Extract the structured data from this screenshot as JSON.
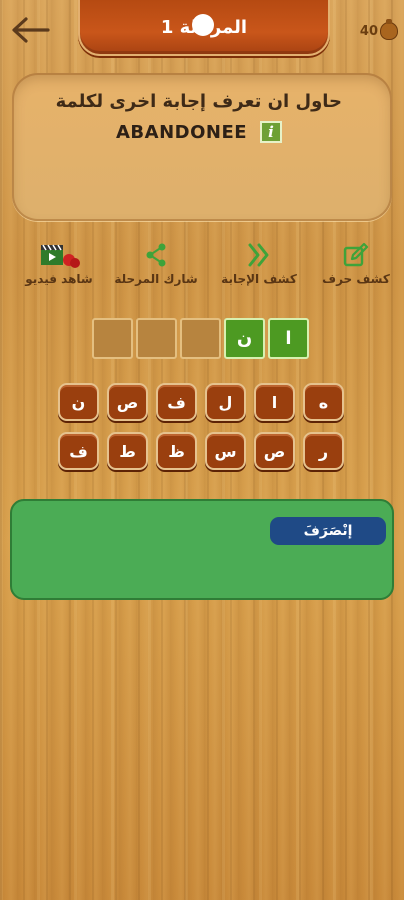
{
  "header": {
    "level_title": "المرحلة 1",
    "coins": "40"
  },
  "question": {
    "prompt": "حاول ان تعرف إجابة اخرى لكلمة",
    "word": "ABANDONEE",
    "info_glyph": "i"
  },
  "actions": [
    {
      "label": "كشف حرف",
      "icon": "edit-icon"
    },
    {
      "label": "كشف الإجابة",
      "icon": "double-chevron-icon"
    },
    {
      "label": "شارك المرحلة",
      "icon": "share-icon"
    },
    {
      "label": "شاهد فيديو",
      "icon": "video-icon"
    }
  ],
  "answer_slots": [
    "",
    "",
    "",
    "ن",
    "ا"
  ],
  "tiles": {
    "row1": [
      "ن",
      "ص",
      "ف",
      "ل",
      "ا",
      "ه"
    ],
    "row2": [
      "ف",
      "ط",
      "ظ",
      "س",
      "ص",
      "ر"
    ]
  },
  "result": {
    "label": "إنْصَرَفَ"
  },
  "colors": {
    "wood": "#d9a45a",
    "banner": "#c9561a",
    "tile": "#9a3f0e",
    "green": "#4bac55",
    "pill": "#1f4a86"
  }
}
